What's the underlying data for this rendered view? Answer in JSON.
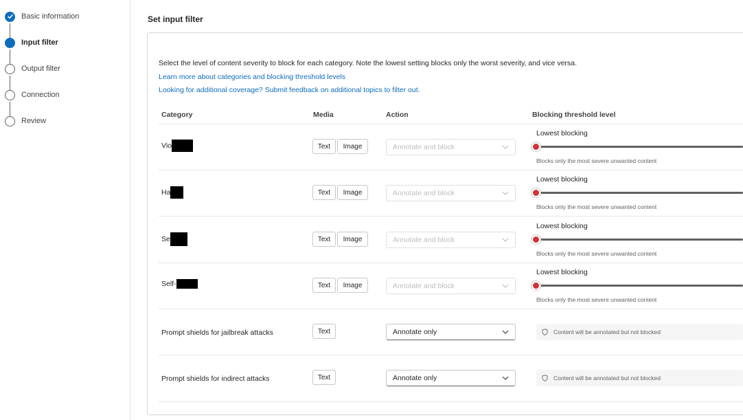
{
  "stepper": {
    "steps": [
      {
        "label": "Basic information",
        "state": "done"
      },
      {
        "label": "Input filter",
        "state": "current"
      },
      {
        "label": "Output filter",
        "state": "pending"
      },
      {
        "label": "Connection",
        "state": "pending"
      },
      {
        "label": "Review",
        "state": "pending"
      }
    ]
  },
  "main": {
    "title": "Set input filter",
    "intro": "Select the level of content severity to block for each category. Note the lowest setting blocks only the worst severity, and vice versa.",
    "links": {
      "learn_more": "Learn more about categories and blocking threshold levels",
      "feedback": "Looking for additional coverage? Submit feedback on additional topics to filter out."
    },
    "table": {
      "headers": {
        "category": "Category",
        "media": "Media",
        "action": "Action",
        "threshold": "Blocking threshold level"
      },
      "rows": [
        {
          "category": "Vio",
          "media": [
            "Text",
            "Image"
          ],
          "action": "Annotate and block",
          "threshold_title": "Lowest blocking",
          "threshold_desc": "Blocks only the most severe unwanted content",
          "threshold_level": 0
        },
        {
          "category": "Ha",
          "media": [
            "Text",
            "Image"
          ],
          "action": "Annotate and block",
          "threshold_title": "Lowest blocking",
          "threshold_desc": "Blocks only the most severe unwanted content",
          "threshold_level": 0
        },
        {
          "category": "Se",
          "media": [
            "Text",
            "Image"
          ],
          "action": "Annotate and block",
          "threshold_title": "Lowest blocking",
          "threshold_desc": "Blocks only the most severe unwanted content",
          "threshold_level": 0
        },
        {
          "category": "Self-",
          "media": [
            "Text",
            "Image"
          ],
          "action": "Annotate and block",
          "threshold_title": "Lowest blocking",
          "threshold_desc": "Blocks only the most severe unwanted content",
          "threshold_level": 0
        },
        {
          "category": "Prompt shields for jailbreak attacks",
          "media": [
            "Text"
          ],
          "action": "Annotate only",
          "info": "Content will be annotated but not blocked"
        },
        {
          "category": "Prompt shields for indirect attacks",
          "media": [
            "Text"
          ],
          "action": "Annotate only",
          "info": "Content will be annotated but not blocked"
        }
      ]
    }
  },
  "colors": {
    "accent": "#0f6cbd",
    "slider_thumb": "#d13438",
    "link": "#0f6cbd"
  },
  "icons": [
    "checkmark-icon",
    "chevron-down-icon",
    "shield-icon"
  ]
}
